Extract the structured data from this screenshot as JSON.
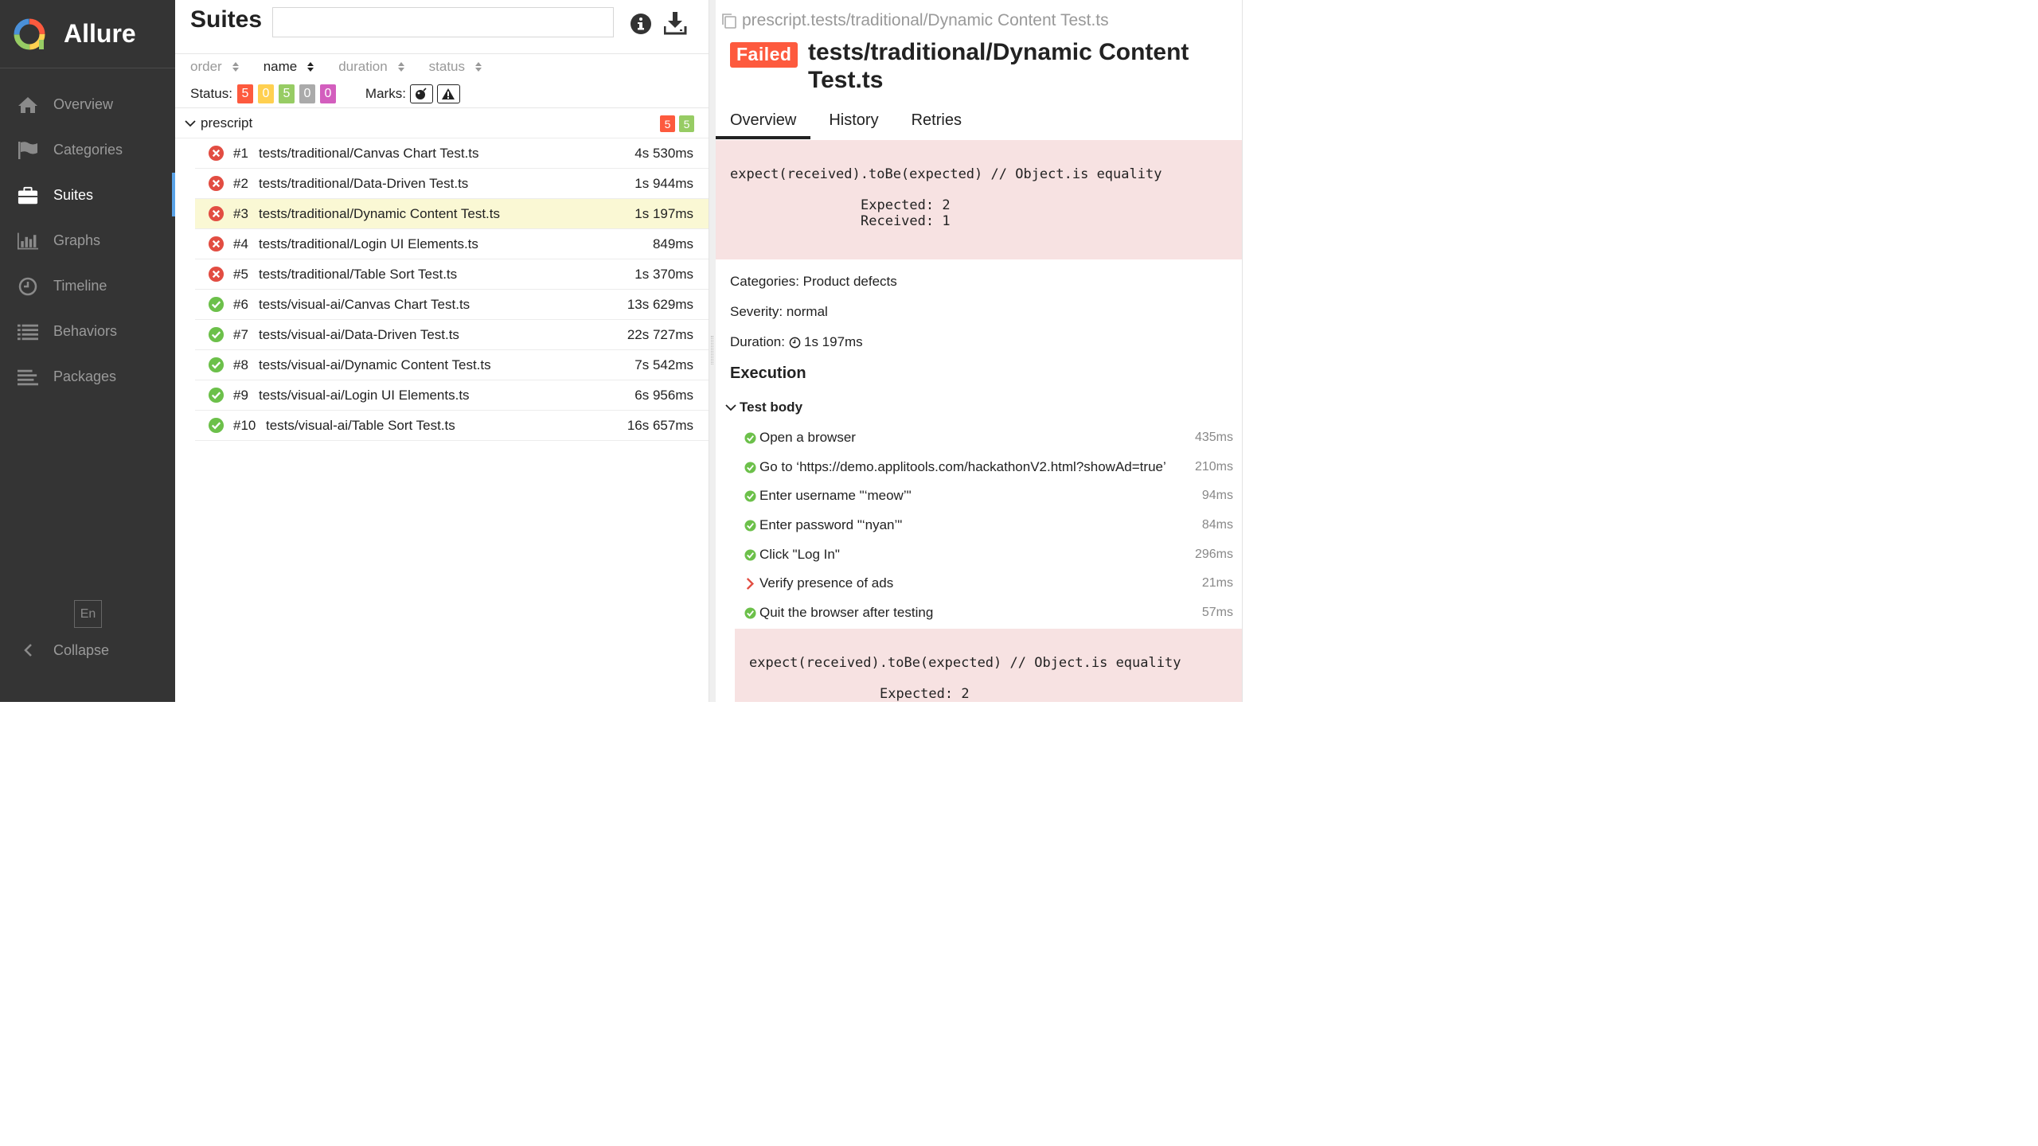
{
  "app": {
    "title": "Allure",
    "logo_colors": [
      "#fd5a3e",
      "#ffd050",
      "#97cc64",
      "#4a90d9"
    ]
  },
  "sidebar": {
    "items": [
      {
        "label": "Overview",
        "icon": "home-icon"
      },
      {
        "label": "Categories",
        "icon": "flag-icon"
      },
      {
        "label": "Suites",
        "icon": "briefcase-icon",
        "active": true
      },
      {
        "label": "Graphs",
        "icon": "bar-chart-icon"
      },
      {
        "label": "Timeline",
        "icon": "clock-icon"
      },
      {
        "label": "Behaviors",
        "icon": "list-icon"
      },
      {
        "label": "Packages",
        "icon": "align-left-icon"
      }
    ],
    "language": "En",
    "collapse_label": "Collapse",
    "active_color": "#5aa3e8"
  },
  "suites": {
    "title": "Suites",
    "search_value": "",
    "sort": {
      "order": "order",
      "name": "name",
      "duration": "duration",
      "status": "status"
    },
    "filter": {
      "status_label": "Status:",
      "counts": {
        "failed": "5",
        "broken": "0",
        "passed": "5",
        "skipped": "0",
        "unknown": "0"
      },
      "marks_label": "Marks:"
    },
    "group": {
      "name": "prescript",
      "failed": "5",
      "passed": "5"
    },
    "rows": [
      {
        "num": "#1",
        "name": "tests/traditional/Canvas Chart Test.ts",
        "duration": "4s 530ms",
        "status": "failed"
      },
      {
        "num": "#2",
        "name": "tests/traditional/Data-Driven Test.ts",
        "duration": "1s 944ms",
        "status": "failed"
      },
      {
        "num": "#3",
        "name": "tests/traditional/Dynamic Content Test.ts",
        "duration": "1s 197ms",
        "status": "failed",
        "selected": true
      },
      {
        "num": "#4",
        "name": "tests/traditional/Login UI Elements.ts",
        "duration": "849ms",
        "status": "failed"
      },
      {
        "num": "#5",
        "name": "tests/traditional/Table Sort Test.ts",
        "duration": "1s 370ms",
        "status": "failed"
      },
      {
        "num": "#6",
        "name": "tests/visual-ai/Canvas Chart Test.ts",
        "duration": "13s 629ms",
        "status": "passed"
      },
      {
        "num": "#7",
        "name": "tests/visual-ai/Data-Driven Test.ts",
        "duration": "22s 727ms",
        "status": "passed"
      },
      {
        "num": "#8",
        "name": "tests/visual-ai/Dynamic Content Test.ts",
        "duration": "7s 542ms",
        "status": "passed"
      },
      {
        "num": "#9",
        "name": "tests/visual-ai/Login UI Elements.ts",
        "duration": "6s 956ms",
        "status": "passed"
      },
      {
        "num": "#10",
        "name": "tests/visual-ai/Table Sort Test.ts",
        "duration": "16s 657ms",
        "status": "passed"
      }
    ]
  },
  "detail": {
    "breadcrumb": "prescript.tests/traditional/Dynamic Content Test.ts",
    "status_label": "Failed",
    "title": "tests/traditional/Dynamic Content Test.ts",
    "tabs": [
      "Overview",
      "History",
      "Retries"
    ],
    "error": {
      "line1": "expect(received).toBe(expected) // Object.is equality",
      "expected": "Expected: 2",
      "received": "Received: 1"
    },
    "categories": "Categories: Product defects",
    "severity": "Severity: normal",
    "duration_label": "Duration:",
    "duration_value": "1s 197ms",
    "execution_title": "Execution",
    "test_body_label": "Test body",
    "steps": [
      {
        "label": "Open a browser",
        "duration": "435ms",
        "status": "passed"
      },
      {
        "label": "Go to ‘https://demo.applitools.com/hackathonV2.html?showAd=true’",
        "duration": "210ms",
        "status": "passed"
      },
      {
        "label": "Enter username \"‘meow’\"",
        "duration": "94ms",
        "status": "passed"
      },
      {
        "label": "Enter password \"‘nyan’\"",
        "duration": "84ms",
        "status": "passed"
      },
      {
        "label": "Click \"Log In\"",
        "duration": "296ms",
        "status": "passed"
      },
      {
        "label": "Verify presence of ads",
        "duration": "21ms",
        "status": "failed"
      },
      {
        "label": "Quit the browser after testing",
        "duration": "57ms",
        "status": "passed"
      }
    ],
    "step_error": {
      "line1": "expect(received).toBe(expected) // Object.is equality",
      "expected": "Expected: 2"
    }
  }
}
